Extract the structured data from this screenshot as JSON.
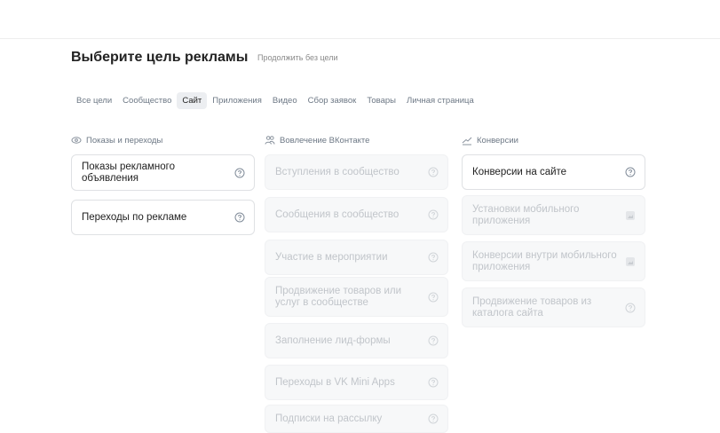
{
  "header": {
    "title": "Выберите цель рекламы",
    "skip_link": "Продолжить без цели"
  },
  "tabs": [
    {
      "label": "Все цели",
      "active": false
    },
    {
      "label": "Сообщество",
      "active": false
    },
    {
      "label": "Сайт",
      "active": true
    },
    {
      "label": "Приложения",
      "active": false
    },
    {
      "label": "Видео",
      "active": false
    },
    {
      "label": "Сбор заявок",
      "active": false
    },
    {
      "label": "Товары",
      "active": false
    },
    {
      "label": "Личная страница",
      "active": false
    }
  ],
  "columns": [
    {
      "heading": "Показы и переходы",
      "icon": "eye-icon",
      "cards": [
        {
          "label": "Показы рекламного объявления",
          "enabled": true,
          "icon": "help-icon"
        },
        {
          "label": "Переходы по рекламе",
          "enabled": true,
          "icon": "help-icon"
        }
      ]
    },
    {
      "heading": "Вовлечение ВКонтакте",
      "icon": "users-icon",
      "cards": [
        {
          "label": "Вступления в сообщество",
          "enabled": false,
          "icon": "help-icon"
        },
        {
          "label": "Сообщения в сообщество",
          "enabled": false,
          "icon": "help-icon"
        },
        {
          "label": "Участие в мероприятии",
          "enabled": false,
          "icon": "help-icon"
        },
        {
          "label": "Продвижение товаров или услуг в сообществе",
          "enabled": false,
          "icon": "help-icon"
        },
        {
          "label": "Заполнение лид-формы",
          "enabled": false,
          "icon": "help-icon"
        },
        {
          "label": "Переходы в VK Mini Apps",
          "enabled": false,
          "icon": "help-icon"
        },
        {
          "label": "Подписки на рассылку",
          "enabled": false,
          "icon": "help-icon"
        }
      ]
    },
    {
      "heading": "Конверсии",
      "icon": "trend-icon",
      "cards": [
        {
          "label": "Конверсии на сайте",
          "enabled": true,
          "icon": "help-icon"
        },
        {
          "label": "Установки мобильного приложения",
          "enabled": false,
          "icon": "image-icon"
        },
        {
          "label": "Конверсии внутри мобильного приложения",
          "enabled": false,
          "icon": "image-icon"
        },
        {
          "label": "Продвижение товаров из каталога сайта",
          "enabled": false,
          "icon": "help-icon"
        }
      ]
    }
  ]
}
